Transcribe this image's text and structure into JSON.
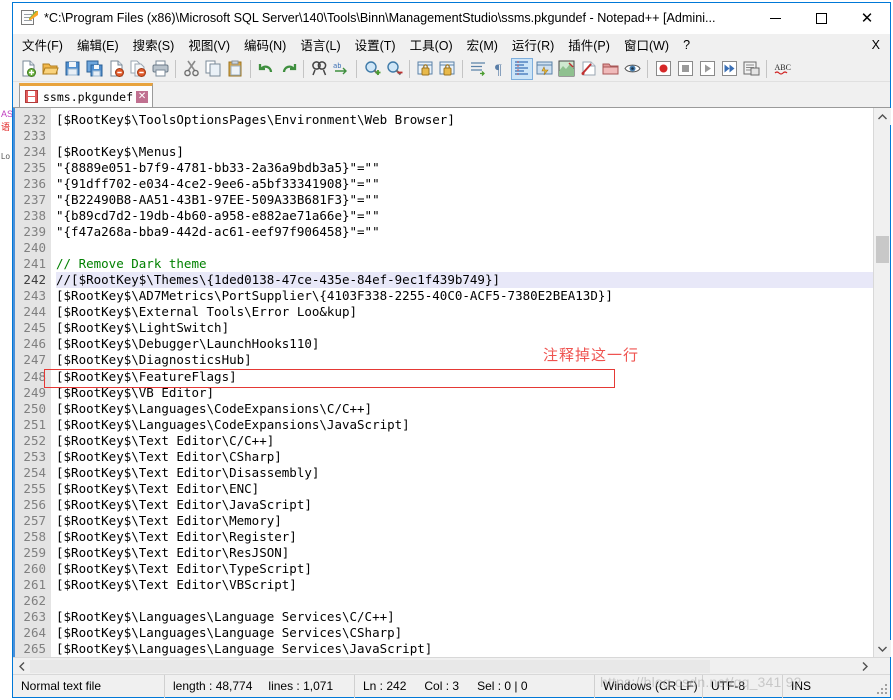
{
  "window": {
    "title": "*C:\\Program Files (x86)\\Microsoft SQL Server\\140\\Tools\\Binn\\ManagementStudio\\ssms.pkgundef - Notepad++ [Admini...",
    "app_icon": "notepad-plus-plus-icon",
    "buttons": {
      "minimize": "minimize-button",
      "maximize": "maximize-button",
      "close": "close-button",
      "close_glyph": "✕"
    },
    "accent_color": "#0078d7"
  },
  "menu": {
    "items": [
      {
        "label": "文件(F)",
        "name": "menu-file"
      },
      {
        "label": "编辑(E)",
        "name": "menu-edit"
      },
      {
        "label": "搜索(S)",
        "name": "menu-search"
      },
      {
        "label": "视图(V)",
        "name": "menu-view"
      },
      {
        "label": "编码(N)",
        "name": "menu-encoding"
      },
      {
        "label": "语言(L)",
        "name": "menu-language"
      },
      {
        "label": "设置(T)",
        "name": "menu-settings"
      },
      {
        "label": "工具(O)",
        "name": "menu-tools"
      },
      {
        "label": "宏(M)",
        "name": "menu-macro"
      },
      {
        "label": "运行(R)",
        "name": "menu-run"
      },
      {
        "label": "插件(P)",
        "name": "menu-plugins"
      },
      {
        "label": "窗口(W)",
        "name": "menu-window"
      },
      {
        "label": "?",
        "name": "menu-help"
      }
    ],
    "doc_close_label": "X"
  },
  "toolbar": {
    "buttons": [
      {
        "name": "new-file-icon",
        "title": "New"
      },
      {
        "name": "open-file-icon",
        "title": "Open"
      },
      {
        "name": "save-icon",
        "title": "Save"
      },
      {
        "name": "save-all-icon",
        "title": "Save All"
      },
      {
        "name": "close-file-icon",
        "title": "Close"
      },
      {
        "name": "close-all-files-icon",
        "title": "Close All"
      },
      {
        "name": "print-icon",
        "title": "Print"
      },
      {
        "name": "separator-1",
        "title": ""
      },
      {
        "name": "cut-icon",
        "title": "Cut"
      },
      {
        "name": "copy-icon",
        "title": "Copy"
      },
      {
        "name": "paste-icon",
        "title": "Paste"
      },
      {
        "name": "separator-2",
        "title": ""
      },
      {
        "name": "undo-icon",
        "title": "Undo"
      },
      {
        "name": "redo-icon",
        "title": "Redo"
      },
      {
        "name": "separator-3",
        "title": ""
      },
      {
        "name": "find-icon",
        "title": "Find"
      },
      {
        "name": "replace-icon",
        "title": "Replace"
      },
      {
        "name": "separator-4",
        "title": ""
      },
      {
        "name": "zoom-in-icon",
        "title": "Zoom In"
      },
      {
        "name": "zoom-out-icon",
        "title": "Zoom Out"
      },
      {
        "name": "separator-5",
        "title": ""
      },
      {
        "name": "sync-vertical-scroll-icon",
        "title": "Synchronize Vertical Scrolling"
      },
      {
        "name": "sync-horizontal-scroll-icon",
        "title": "Synchronize Horizontal Scrolling"
      },
      {
        "name": "separator-6",
        "title": ""
      },
      {
        "name": "word-wrap-icon",
        "title": "Word Wrap"
      },
      {
        "name": "show-all-characters-icon",
        "title": "Show All Characters"
      },
      {
        "name": "indent-guide-icon",
        "title": "Show Indent Guide",
        "active": true
      },
      {
        "name": "user-defined-language-icon",
        "title": "User Defined Dialogue"
      },
      {
        "name": "document-map-icon",
        "title": "Document Map"
      },
      {
        "name": "function-list-icon",
        "title": "Function List"
      },
      {
        "name": "folder-workspace-icon",
        "title": "Folder as Workspace"
      },
      {
        "name": "monitoring-icon",
        "title": "Monitoring"
      },
      {
        "name": "separator-7",
        "title": ""
      },
      {
        "name": "record-macro-icon",
        "title": "Start Recording"
      },
      {
        "name": "stop-macro-icon",
        "title": "Stop Recording"
      },
      {
        "name": "play-macro-icon",
        "title": "Playback"
      },
      {
        "name": "run-macro-multiple-icon",
        "title": "Run a Macro Multiple Times"
      },
      {
        "name": "save-macro-icon",
        "title": "Save Current Recorded Macro"
      },
      {
        "name": "separator-8",
        "title": ""
      },
      {
        "name": "spell-check-icon",
        "title": "Spell Check"
      }
    ]
  },
  "tabs": [
    {
      "label": "ssms.pkgundef",
      "name": "document-tab-ssms-pkgundef",
      "modified": true,
      "close_glyph": "✕"
    }
  ],
  "editor": {
    "first_line_number": 232,
    "current_line": 242,
    "lines": [
      {
        "n": 232,
        "text": "[$RootKey$\\ToolsOptionsPages\\Environment\\Web Browser]"
      },
      {
        "n": 233,
        "text": ""
      },
      {
        "n": 234,
        "text": "[$RootKey$\\Menus]"
      },
      {
        "n": 235,
        "text": "\"{8889e051-b7f9-4781-bb33-2a36a9bdb3a5}\"=\"\""
      },
      {
        "n": 236,
        "text": "\"{91dff702-e034-4ce2-9ee6-a5bf33341908}\"=\"\""
      },
      {
        "n": 237,
        "text": "\"{B22490B8-AA51-43B1-97EE-509A33B681F3}\"=\"\""
      },
      {
        "n": 238,
        "text": "\"{b89cd7d2-19db-4b60-a958-e882ae71a66e}\"=\"\""
      },
      {
        "n": 239,
        "text": "\"{f47a268a-bba9-442d-ac61-eef97f906458}\"=\"\""
      },
      {
        "n": 240,
        "text": ""
      },
      {
        "n": 241,
        "text": "// Remove Dark theme",
        "comment": true
      },
      {
        "n": 242,
        "text": "//[$RootKey$\\Themes\\{1ded0138-47ce-435e-84ef-9ec1f439b749}]",
        "current": true
      },
      {
        "n": 243,
        "text": "[$RootKey$\\AD7Metrics\\PortSupplier\\{4103F338-2255-40C0-ACF5-7380E2BEA13D}]"
      },
      {
        "n": 244,
        "text": "[$RootKey$\\External Tools\\Error Loo&kup]"
      },
      {
        "n": 245,
        "text": "[$RootKey$\\LightSwitch]"
      },
      {
        "n": 246,
        "text": "[$RootKey$\\Debugger\\LaunchHooks110]"
      },
      {
        "n": 247,
        "text": "[$RootKey$\\DiagnosticsHub]"
      },
      {
        "n": 248,
        "text": "[$RootKey$\\FeatureFlags]"
      },
      {
        "n": 249,
        "text": "[$RootKey$\\VB Editor]"
      },
      {
        "n": 250,
        "text": "[$RootKey$\\Languages\\CodeExpansions\\C/C++]"
      },
      {
        "n": 251,
        "text": "[$RootKey$\\Languages\\CodeExpansions\\JavaScript]"
      },
      {
        "n": 252,
        "text": "[$RootKey$\\Text Editor\\C/C++]"
      },
      {
        "n": 253,
        "text": "[$RootKey$\\Text Editor\\CSharp]"
      },
      {
        "n": 254,
        "text": "[$RootKey$\\Text Editor\\Disassembly]"
      },
      {
        "n": 255,
        "text": "[$RootKey$\\Text Editor\\ENC]"
      },
      {
        "n": 256,
        "text": "[$RootKey$\\Text Editor\\JavaScript]"
      },
      {
        "n": 257,
        "text": "[$RootKey$\\Text Editor\\Memory]"
      },
      {
        "n": 258,
        "text": "[$RootKey$\\Text Editor\\Register]"
      },
      {
        "n": 259,
        "text": "[$RootKey$\\Text Editor\\ResJSON]"
      },
      {
        "n": 260,
        "text": "[$RootKey$\\Text Editor\\TypeScript]"
      },
      {
        "n": 261,
        "text": "[$RootKey$\\Text Editor\\VBScript]"
      },
      {
        "n": 262,
        "text": ""
      },
      {
        "n": 263,
        "text": "[$RootKey$\\Languages\\Language Services\\C/C++]"
      },
      {
        "n": 264,
        "text": "[$RootKey$\\Languages\\Language Services\\CSharp]"
      },
      {
        "n": 265,
        "text": "[$RootKey$\\Languages\\Language Services\\JavaScript]"
      }
    ]
  },
  "annotation": {
    "text": "注释掉这一行",
    "color": "#ef5350",
    "box_color": "#e53935"
  },
  "status_bar": {
    "file_type": "Normal text file",
    "length_label": "length : 48,774",
    "lines_label": "lines : 1,071",
    "ln_label": "Ln : 242",
    "col_label": "Col : 3",
    "sel_label": "Sel : 0 | 0",
    "eol": "Windows (CR LF)",
    "encoding": "UTF-8",
    "insert_mode": "INS"
  },
  "watermark": "https://blog.csdn.net/qq_341  92",
  "background_strip": {
    "lines": [
      "●",
      "语",
      "",
      "",
      "Lo"
    ]
  }
}
